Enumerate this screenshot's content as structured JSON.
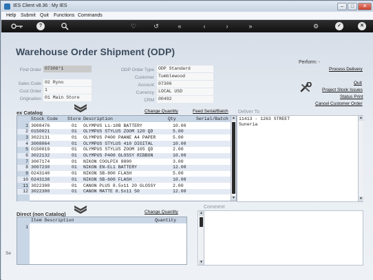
{
  "window": {
    "title": "IES Client v8.36 : My IES",
    "minimize": "–",
    "maximize": "□",
    "close": "✕"
  },
  "menu": [
    "Help",
    "Submit",
    "Quit",
    "Functions",
    "Commands"
  ],
  "toolbar_icons": [
    "key-icon",
    "help-icon",
    "search-icon",
    "heart-icon",
    "undo-icon",
    "rewind-icon",
    "back-icon",
    "forward-icon",
    "fast-forward-icon",
    "settings-icon",
    "ok-icon",
    "close-icon"
  ],
  "page_title": "Warehouse Order Shipment (ODP)",
  "form": {
    "find_order_label": "Find Order",
    "find_order_value": "07306*1",
    "sales_code_label": "Sales Code",
    "sales_code_value": "02 Ryno",
    "cust_order_label": "Cust Order",
    "cust_order_value": "1",
    "origination_label": "Origination",
    "origination_value": "01 Main Store",
    "odp_order_type_label": "ODP Order Type",
    "odp_order_type_value": "ODP Standard",
    "customer_label": "Customer",
    "customer_value": "Tumblewood",
    "account_label": "Account",
    "account_value": "07306",
    "currency_label": "Currency",
    "currency_value": "LOCAL USD",
    "crm_label": "CRM",
    "crm_value": "00492"
  },
  "perform": {
    "label": "Perform: -",
    "process_delivery": "Process Delivery",
    "quit": "Quit",
    "project_stock_issues": "Project Stock Issues",
    "status_print": "Status Print",
    "cancel_customer_order": "Cancel Customer Order"
  },
  "catalog": {
    "title": "ex Catalog",
    "change_quantity": "Change Quantity",
    "feed_serial_batch": "Feed Serial/Batch",
    "headers": {
      "stock_code": "Stock Code",
      "store": "Store",
      "description": "Description",
      "qty": "Qty",
      "serial_batch": "Serial/Batch"
    },
    "rows": [
      {
        "n": "1",
        "code": "3008476",
        "store": "01",
        "desc": "OLYMPUS Li-10B BATTERY",
        "qty": "10.00"
      },
      {
        "n": "2",
        "code": "0150021",
        "store": "01",
        "desc": "OLYMPUS STYLUS ZOOM 120 QD",
        "qty": "5.00"
      },
      {
        "n": "3",
        "code": "3022131",
        "store": "01",
        "desc": "OLYMPUS P400 PAANE A4 PAPER",
        "qty": "5.00"
      },
      {
        "n": "4",
        "code": "3008064",
        "store": "01",
        "desc": "OLYMPUS STYLUS 410 DIGITAL",
        "qty": "10.00"
      },
      {
        "n": "5",
        "code": "0150019",
        "store": "01",
        "desc": "OLYMPUS STYLUS ZOOM 105 QD",
        "qty": "2.00"
      },
      {
        "n": "6",
        "code": "3022132",
        "store": "01",
        "desc": "OLYMPUS P400 GLOSSY RIBBON",
        "qty": "10.00"
      },
      {
        "n": "7",
        "code": "3007174",
        "store": "01",
        "desc": "NIKON COOLPIX 8800",
        "qty": "3.00"
      },
      {
        "n": "8",
        "code": "3007230",
        "store": "01",
        "desc": "NIKON EN-EL1 BATTERY",
        "qty": "12.00"
      },
      {
        "n": "9",
        "code": "0243140",
        "store": "01",
        "desc": "NIKON SB-800 FLASH",
        "qty": "5.00"
      },
      {
        "n": "10",
        "code": "0243138",
        "store": "01",
        "desc": "NIKON SB-600 FLASH",
        "qty": "10.00"
      },
      {
        "n": "11",
        "code": "3022308",
        "store": "01",
        "desc": "CANON PLUS 8.5x11 20 GLOSSY",
        "qty": "2.00"
      },
      {
        "n": "12",
        "code": "3022300",
        "store": "01",
        "desc": "CANON MATTE 8.5x11 50",
        "qty": "12.00"
      }
    ]
  },
  "deliver_to": {
    "title": "Deliver To",
    "line1": "11413 - 1263 STREET",
    "line2": "Suneria"
  },
  "direct": {
    "title": "Direct (non Catalog)",
    "change_quantity": "Change Quantity",
    "headers": {
      "item_description": "Item Description",
      "quantity": "Quantity"
    },
    "first_row": "1"
  },
  "comment": {
    "title": "Comment"
  },
  "side_fragment": "Se"
}
